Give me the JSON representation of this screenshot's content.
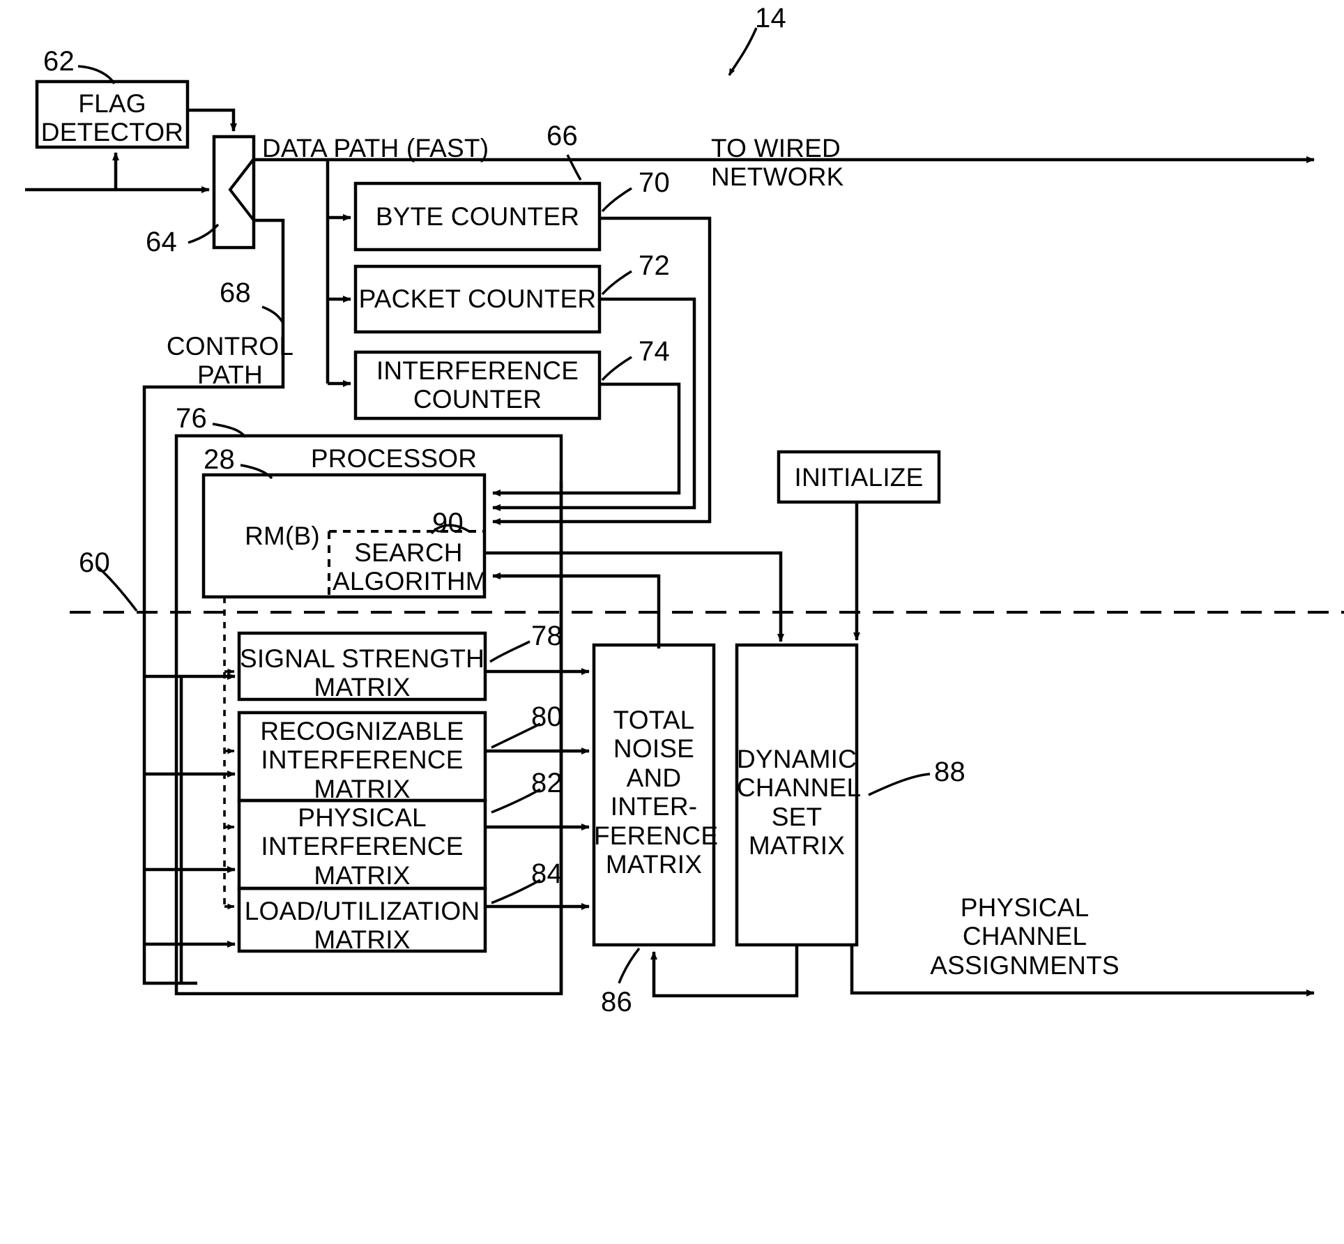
{
  "figure": {
    "title_ref": "14",
    "boxes": {
      "flag_detector": "FLAG\nDETECTOR",
      "byte_counter": "BYTE COUNTER",
      "packet_counter": "PACKET COUNTER",
      "interference_counter": "INTERFERENCE\nCOUNTER",
      "processor": "PROCESSOR",
      "rm_b": "RM(B)",
      "search_algorithm": "SEARCH\nALGORITHM",
      "signal_strength_matrix": "SIGNAL STRENGTH\nMATRIX",
      "recognizable_interference_matrix": "RECOGNIZABLE\nINTERFERENCE\nMATRIX",
      "physical_interference_matrix": "PHYSICAL\nINTERFERENCE\nMATRIX",
      "load_utilization_matrix": "LOAD/UTILIZATION\nMATRIX",
      "total_noise_matrix": "TOTAL\nNOISE\nAND\nINTER-\nFERENCE\nMATRIX",
      "dynamic_channel_set_matrix": "DYNAMIC\nCHANNEL\nSET MATRIX",
      "initialize": "INITIALIZE"
    },
    "path_labels": {
      "data_path": "DATA PATH (FAST)",
      "control_path": "CONTROL\nPATH",
      "to_wired_network": "TO WIRED NETWORK",
      "physical_channel_assignments": "PHYSICAL\nCHANNEL\nASSIGNMENTS"
    },
    "reference_numerals": {
      "n14": "14",
      "n28": "28",
      "n60": "60",
      "n62": "62",
      "n64": "64",
      "n66": "66",
      "n68": "68",
      "n70": "70",
      "n72": "72",
      "n74": "74",
      "n76": "76",
      "n78": "78",
      "n80": "80",
      "n82": "82",
      "n84": "84",
      "n86": "86",
      "n88": "88",
      "n90": "90"
    },
    "colors": {
      "line": "#000000",
      "background": "#ffffff"
    }
  }
}
